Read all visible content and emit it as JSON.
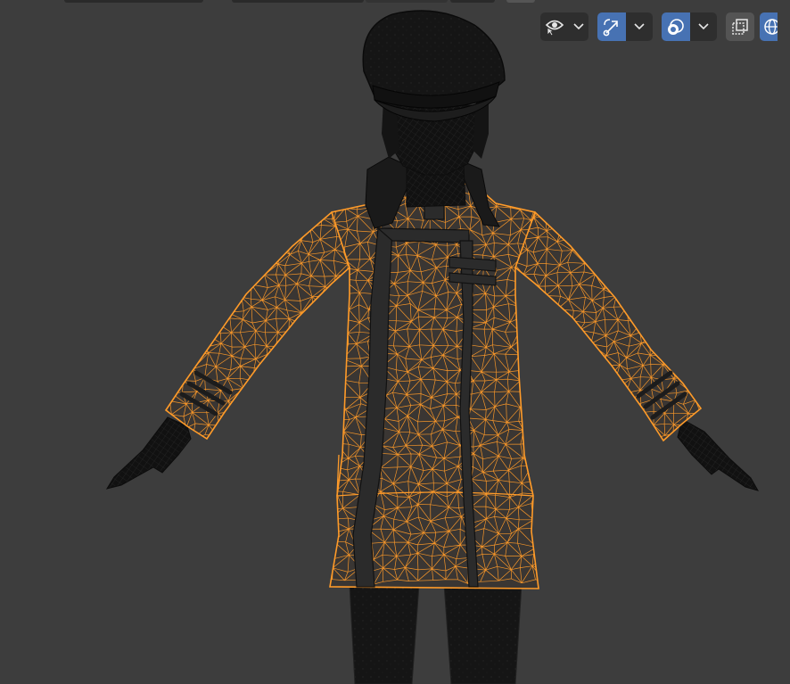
{
  "viewport": {
    "background": "#3d3d3d",
    "selection_color": "#ff9b29",
    "unselected_color": "#1a1a1a"
  },
  "header": {
    "visibility": {
      "icon": "eye-cursor-icon",
      "dropdown": "chevron-down-icon"
    },
    "gizmo": {
      "icon": "gizmo-icon",
      "active": true,
      "dropdown": "chevron-down-icon"
    },
    "overlays": {
      "icon": "overlays-icon",
      "active": true,
      "dropdown": "chevron-down-icon"
    },
    "xray": {
      "icon": "xray-toggle-icon",
      "active": false
    },
    "shading": {
      "icon": "wireframe-sphere-icon",
      "active": true
    }
  },
  "scene": {
    "selected_object": "coat",
    "other_objects": [
      "hat",
      "head",
      "collar",
      "hands",
      "legs",
      "placket-straps"
    ]
  }
}
